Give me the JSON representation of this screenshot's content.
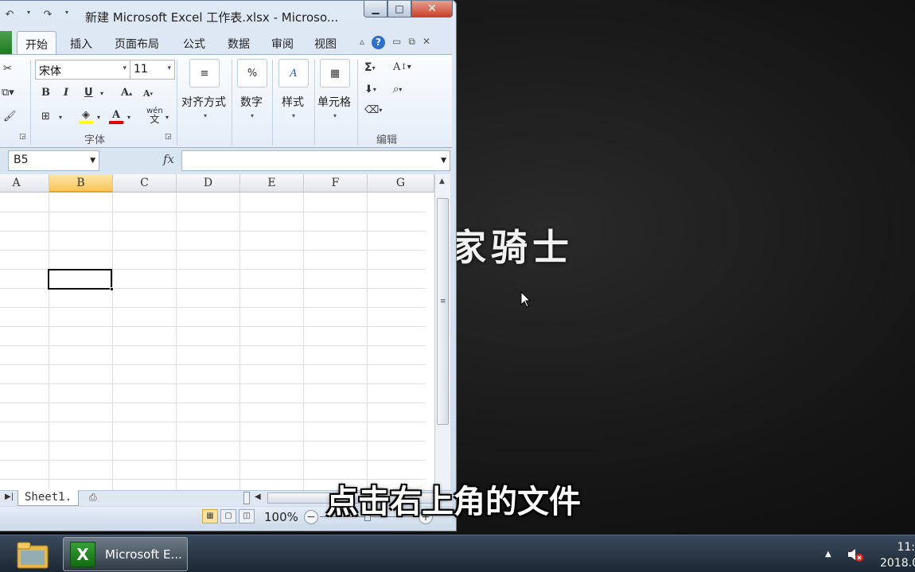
{
  "desktop": {
    "title_text": "家骑士"
  },
  "window": {
    "title": "新建 Microsoft Excel 工作表.xlsx - Microso...",
    "qat": {
      "undo": "↶",
      "redo": "↷"
    },
    "controls": {
      "minimize": "▁",
      "maximize": "□",
      "close": "✕"
    }
  },
  "ribbon": {
    "tabs": [
      "开始",
      "插入",
      "页面布局",
      "公式",
      "数据",
      "审阅",
      "视图"
    ],
    "font": {
      "name": "宋体",
      "size": "11",
      "group_label": "字体",
      "bold": "B",
      "italic": "I",
      "underline": "U",
      "grow": "A",
      "shrink": "A",
      "wen": "wén"
    },
    "alignment_label": "对齐方式",
    "number_label": "数字",
    "number_icon": "%",
    "styles_label": "样式",
    "cells_label": "单元格",
    "editing_label": "编辑",
    "editing": {
      "sum": "Σ",
      "sort": "A",
      "find": "A"
    }
  },
  "formula_bar": {
    "name_box": "B5",
    "fx": "fx",
    "value": ""
  },
  "sheet": {
    "columns": [
      "A",
      "B",
      "C",
      "D",
      "E",
      "F",
      "G"
    ],
    "selected_column": "B",
    "active_cell": "B5"
  },
  "sheet_tabs": {
    "active": "Sheet1."
  },
  "status": {
    "zoom": "100%",
    "minus": "−",
    "plus": "+"
  },
  "subtitle": "点击右上角的文件",
  "taskbar": {
    "excel_label": "Microsoft E...",
    "clock_time": "11:",
    "clock_date": "2018.0"
  },
  "colors": {
    "excel_green": "#1e7a1e",
    "selected_header": "#f7c55b",
    "close_red": "#c8422c"
  }
}
